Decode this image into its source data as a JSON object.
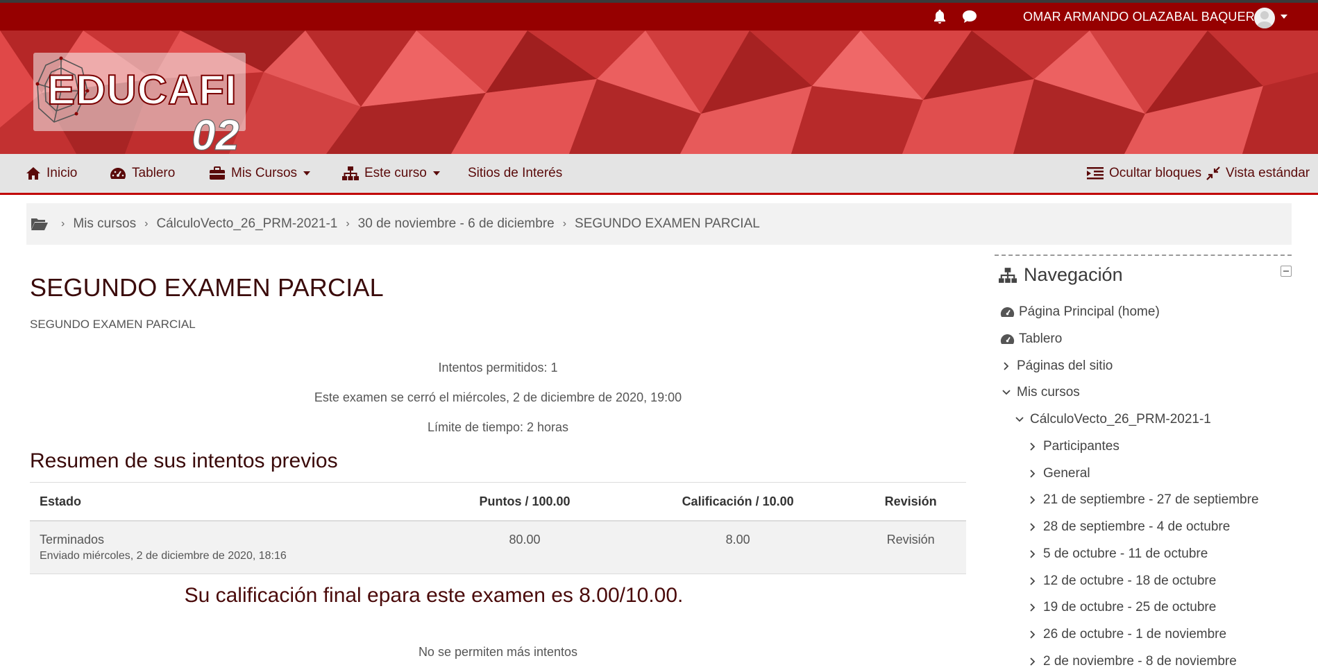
{
  "topbar": {
    "user_name": "OMAR ARMANDO OLAZABAL BAQUERO",
    "icons": [
      "bell-icon",
      "chat-icon",
      "avatar",
      "chevron-down-icon"
    ]
  },
  "brand": {
    "name": "EDUCAFI",
    "suffix": "02"
  },
  "navbar": {
    "home": "Inicio",
    "dashboard": "Tablero",
    "my_courses": "Mis Cursos",
    "this_course": "Este curso",
    "sites": "Sitios de Interés",
    "hide_blocks": "Ocultar bloques",
    "standard_view": "Vista estándar"
  },
  "breadcrumb": {
    "items": [
      "Mis cursos",
      "CálculoVecto_26_PRM-2021-1",
      "30 de noviembre - 6 de diciembre",
      "SEGUNDO EXAMEN PARCIAL"
    ]
  },
  "main": {
    "title": "SEGUNDO EXAMEN PARCIAL",
    "intro": "SEGUNDO EXAMEN PARCIAL",
    "attempts_allowed": "Intentos permitidos: 1",
    "closed": "Este examen se cerró el miércoles, 2 de diciembre de 2020, 19:00",
    "time_limit": "Límite de tiempo: 2 horas",
    "summary_heading": "Resumen de sus intentos previos",
    "table": {
      "headers": [
        "Estado",
        "Puntos / 100.00",
        "Calificación / 10.00",
        "Revisión"
      ],
      "rows": [
        {
          "estado": "Terminados",
          "enviado": "Enviado miércoles, 2 de diciembre de 2020, 18:16",
          "puntos": "80.00",
          "calificacion": "8.00",
          "revision": "Revisión"
        }
      ]
    },
    "final_grade": "Su calificación final epara este examen es 8.00/10.00.",
    "no_more": "No se permiten más intentos"
  },
  "sidebar": {
    "title": "Navegación",
    "items": [
      {
        "label": "Página Principal (home)",
        "icon": "dashboard-icon"
      },
      {
        "label": "Tablero",
        "icon": "dashboard-icon"
      },
      {
        "label": "Páginas del sitio",
        "icon": "chevron-right-icon"
      },
      {
        "label": "Mis cursos",
        "icon": "chevron-down-icon"
      },
      {
        "label": "CálculoVecto_26_PRM-2021-1",
        "icon": "chevron-down-icon"
      },
      {
        "label": "Participantes",
        "icon": "chevron-right-icon"
      },
      {
        "label": "General",
        "icon": "chevron-right-icon"
      },
      {
        "label": "21 de septiembre - 27 de septiembre",
        "icon": "chevron-right-icon"
      },
      {
        "label": "28 de septiembre - 4 de octubre",
        "icon": "chevron-right-icon"
      },
      {
        "label": "5 de octubre - 11 de octubre",
        "icon": "chevron-right-icon"
      },
      {
        "label": "12 de octubre - 18 de octubre",
        "icon": "chevron-right-icon"
      },
      {
        "label": "19 de octubre - 25 de octubre",
        "icon": "chevron-right-icon"
      },
      {
        "label": "26 de octubre - 1 de noviembre",
        "icon": "chevron-right-icon"
      },
      {
        "label": "2 de noviembre - 8 de noviembre",
        "icon": "chevron-right-icon"
      }
    ]
  },
  "colors": {
    "topbar": "#960000",
    "navbar_bg": "#e4e4e4",
    "accent_line": "#c00000",
    "heading": "#3a0a0a"
  }
}
